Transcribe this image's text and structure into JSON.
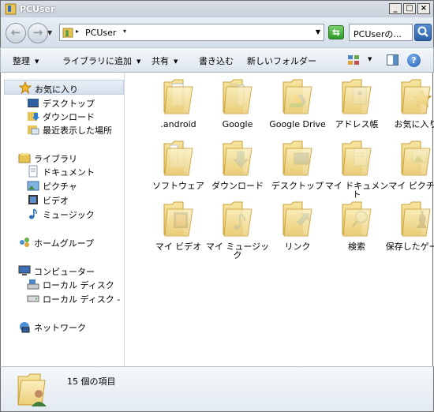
{
  "window": {
    "title": "PCUser"
  },
  "address": {
    "path": "PCUser",
    "search_placeholder": "PCUserの..."
  },
  "commands": [
    "整理",
    "ライブラリに追加",
    "共有",
    "書き込む",
    "新しいフォルダー"
  ],
  "nav": {
    "favorites": {
      "label": "お気に入り",
      "items": [
        "デスクトップ",
        "ダウンロード",
        "最近表示した場所"
      ]
    },
    "libraries": {
      "label": "ライブラリ",
      "items": [
        "ドキュメント",
        "ピクチャ",
        "ビデオ",
        "ミュージック"
      ]
    },
    "homegroup": "ホームグループ",
    "computer": {
      "label": "コンピューター",
      "items": [
        "ローカル ディスク",
        "ローカル ディスク - レ"
      ]
    },
    "network": "ネットワーク"
  },
  "folders": [
    ".android",
    "Google",
    "Google Drive",
    "アドレス帳",
    "お気に入り",
    "ソフトウェア",
    "ダウンロード",
    "デスクトップ",
    "マイ ドキュメント",
    "マイ ピクチャ",
    "マイ ビデオ",
    "マイ ミュージック",
    "リンク",
    "検索",
    "保存したゲーム"
  ],
  "details": {
    "count_text": "15 個の項目"
  }
}
